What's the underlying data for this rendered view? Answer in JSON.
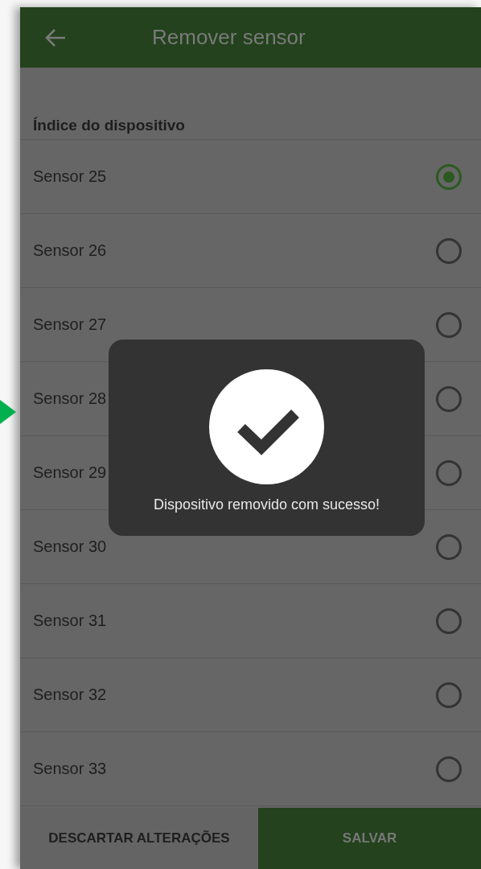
{
  "app_bar": {
    "title": "Remover sensor"
  },
  "list": {
    "header": "Índice do dispositivo",
    "items": [
      {
        "label": "Sensor 25",
        "selected": true
      },
      {
        "label": "Sensor 26",
        "selected": false
      },
      {
        "label": "Sensor 27",
        "selected": false
      },
      {
        "label": "Sensor 28",
        "selected": false
      },
      {
        "label": "Sensor 29",
        "selected": false
      },
      {
        "label": "Sensor 30",
        "selected": false
      },
      {
        "label": "Sensor 31",
        "selected": false
      },
      {
        "label": "Sensor 32",
        "selected": false
      },
      {
        "label": "Sensor 33",
        "selected": false
      }
    ]
  },
  "toast": {
    "message": "Dispositivo removido com sucesso!"
  },
  "buttons": [
    {
      "label": "DESCARTAR ALTERAÇÕES",
      "kind": "secondary"
    },
    {
      "label": "SALVAR",
      "kind": "primary"
    }
  ]
}
